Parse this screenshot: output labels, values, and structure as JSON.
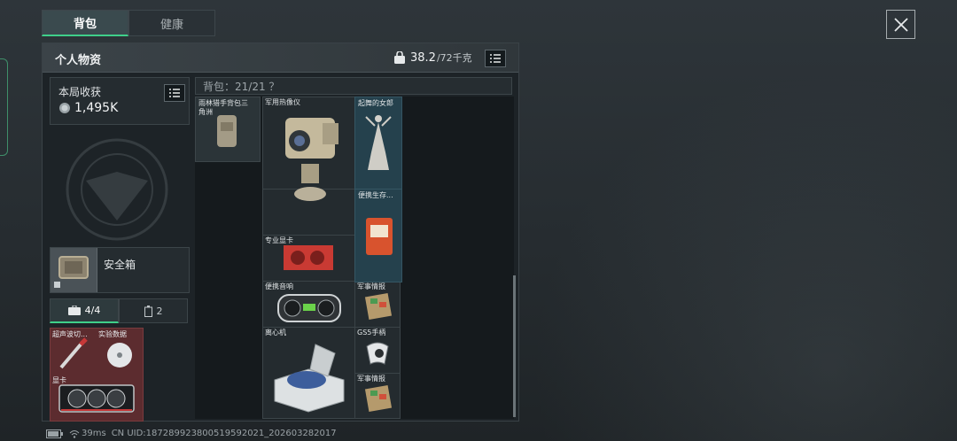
{
  "tabs": [
    {
      "label": "背包",
      "active": true
    },
    {
      "label": "健康",
      "active": false
    }
  ],
  "panel": {
    "title": "个人物资",
    "weight_current": "38.2",
    "weight_max": "/72千克"
  },
  "loot": {
    "title": "本局收获",
    "value": "1,495K"
  },
  "safe": {
    "label": "安全箱"
  },
  "slot_tabs": [
    {
      "count": "4/4",
      "icon": "briefcase-icon",
      "active": true
    },
    {
      "count": "2",
      "icon": "battery-icon",
      "active": false
    }
  ],
  "safe_items": [
    {
      "label": "超声波切...",
      "icon": "ultrasonic-cutter-icon"
    },
    {
      "label": "实验数据",
      "icon": "data-disc-icon"
    },
    {
      "label": "显卡",
      "icon": "graphics-card-icon"
    }
  ],
  "backpack": {
    "label": "背包：21/21 ？"
  },
  "backpack_items": [
    {
      "label": "雨林猎手背包三角洲",
      "icon": "backpack-icon"
    },
    {
      "label": "军用热像仪",
      "icon": "thermal-imager-icon"
    },
    {
      "label": "起舞的女郎",
      "icon": "dancing-lady-statue-icon"
    },
    {
      "label": "便携生存...",
      "icon": "survival-kit-icon"
    },
    {
      "label": "专业显卡",
      "icon": "pro-graphics-card-icon"
    },
    {
      "label": "便携音响",
      "icon": "boombox-icon"
    },
    {
      "label": "军事情报",
      "icon": "intel-board-icon"
    },
    {
      "label": "离心机",
      "icon": "centrifuge-icon"
    },
    {
      "label": "GS5手柄",
      "icon": "gamepad-icon"
    },
    {
      "label": "军事情报",
      "icon": "intel-board-icon"
    }
  ],
  "footer": {
    "ping": "39ms",
    "uid": "CN UID:18728992380051959202​1_202603282017"
  },
  "colors": {
    "accent": "#3fd08a",
    "safe_bg": "#5c2c2f",
    "rare_bg": "#25414d"
  }
}
